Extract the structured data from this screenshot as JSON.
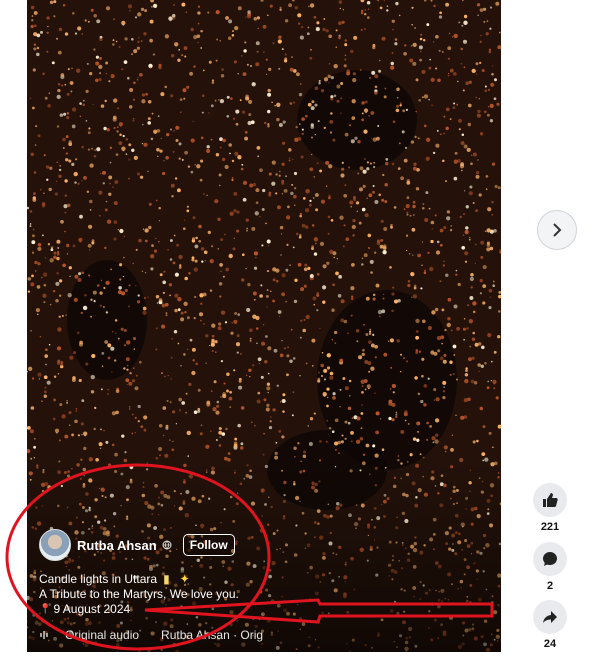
{
  "post": {
    "author": "Rutba Ahsan",
    "follow_label": "Follow",
    "caption_line1": "Candle lights in Uttara",
    "caption_line2": "A Tribute to the Martyrs, We love you.",
    "date": "9 August 2024",
    "audio_label": "Original audio",
    "audio_source": "Rutba Ahsan · Orig"
  },
  "actions": {
    "likes": "221",
    "comments": "2",
    "shares": "24"
  },
  "icons": {
    "next": "chevron-right-icon",
    "like": "thumbs-up-icon",
    "comment": "comment-icon",
    "share": "share-icon",
    "globe": "globe-icon",
    "pin": "map-pin-icon",
    "audio": "audio-icon"
  },
  "colors": {
    "annotation": "#e0141e",
    "candle": "#ffb46a"
  }
}
